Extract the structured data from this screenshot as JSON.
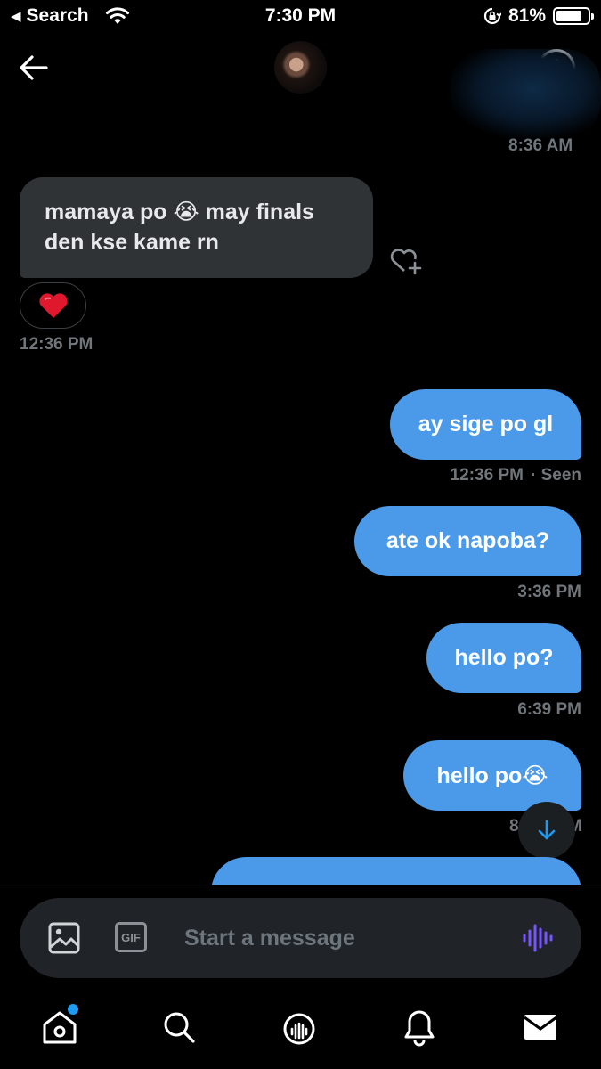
{
  "status_bar": {
    "back_label": "Search",
    "time": "7:30 PM",
    "battery": "81%",
    "battery_level": 0.81
  },
  "header": {
    "back_icon": "arrow-left-icon",
    "info_icon": "info-icon",
    "info_glyph": "i"
  },
  "previous_time_clipped": "8:36 AM",
  "messages": {
    "incoming": {
      "text_line1": "mamaya po 😭 may finals",
      "text_line2": "den kse kame rn",
      "reaction": "❤️",
      "time": "12:36 PM"
    },
    "outgoing": [
      {
        "text": "ay sige po gl",
        "time": "12:36 PM",
        "status": "· Seen"
      },
      {
        "text": "ate ok napoba?",
        "time": "3:36 PM"
      },
      {
        "text": "hello po?",
        "time": "6:39 PM"
      },
      {
        "text": "hello po😭",
        "time": "8:__ PM"
      }
    ],
    "time_visible_left": "8",
    "time_visible_right": "M"
  },
  "composer": {
    "placeholder": "Start a message",
    "gif_label": "GIF"
  },
  "tabs": [
    "home",
    "search",
    "spaces",
    "notifications",
    "messages"
  ],
  "colors": {
    "accent": "#1d9bf0",
    "bubble_out": "#4b9ae9",
    "bubble_in": "#2f3336",
    "voice": "#7856ff"
  }
}
